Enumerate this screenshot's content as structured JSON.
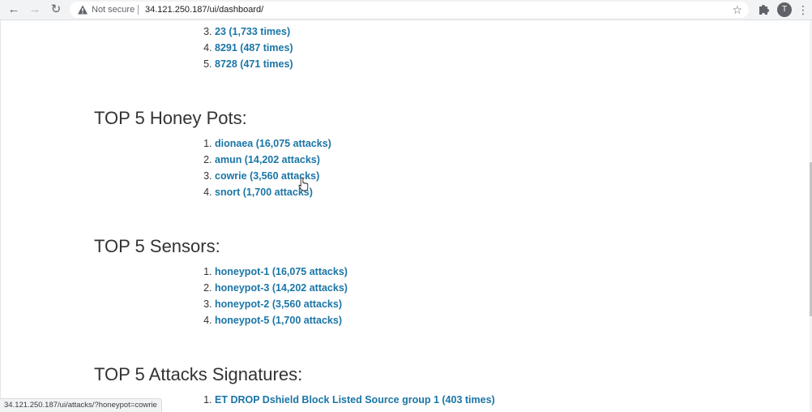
{
  "browser": {
    "security_label": "Not secure",
    "url": "34.121.250.187/ui/dashboard/",
    "profile_initial": "T",
    "icons": {
      "back": "arrow-left-icon",
      "forward": "arrow-right-icon",
      "reload": "reload-icon",
      "warning": "warning-triangle-icon",
      "star": "star-icon",
      "extensions": "puzzle-icon",
      "menu": "more-vert-icon"
    }
  },
  "ports_tail": {
    "items": [
      {
        "number": "3.",
        "label": "23 (1,733 times)"
      },
      {
        "number": "4.",
        "label": "8291 (487 times)"
      },
      {
        "number": "5.",
        "label": "8728 (471 times)"
      }
    ]
  },
  "honeypots": {
    "title": "TOP 5 Honey Pots:",
    "items": [
      {
        "label": "dionaea (16,075 attacks)"
      },
      {
        "label": "amun (14,202 attacks)"
      },
      {
        "label": "cowrie (3,560 attacks)"
      },
      {
        "label": "snort (1,700 attacks)"
      }
    ]
  },
  "sensors": {
    "title": "TOP 5 Sensors:",
    "items": [
      {
        "label": "honeypot-1 (16,075 attacks)"
      },
      {
        "label": "honeypot-3 (14,202 attacks)"
      },
      {
        "label": "honeypot-2 (3,560 attacks)"
      },
      {
        "label": "honeypot-5 (1,700 attacks)"
      }
    ]
  },
  "signatures": {
    "title": "TOP 5 Attacks Signatures:",
    "items": [
      {
        "label": "ET DROP Dshield Block Listed Source group 1 (403 times)"
      }
    ]
  },
  "status_bar": {
    "text": "34.121.250.187/ui/attacks/?honeypot=cowrie"
  },
  "colors": {
    "link": "#1b75a6",
    "heading": "#333333",
    "chrome_bg": "#f1f3f4"
  }
}
